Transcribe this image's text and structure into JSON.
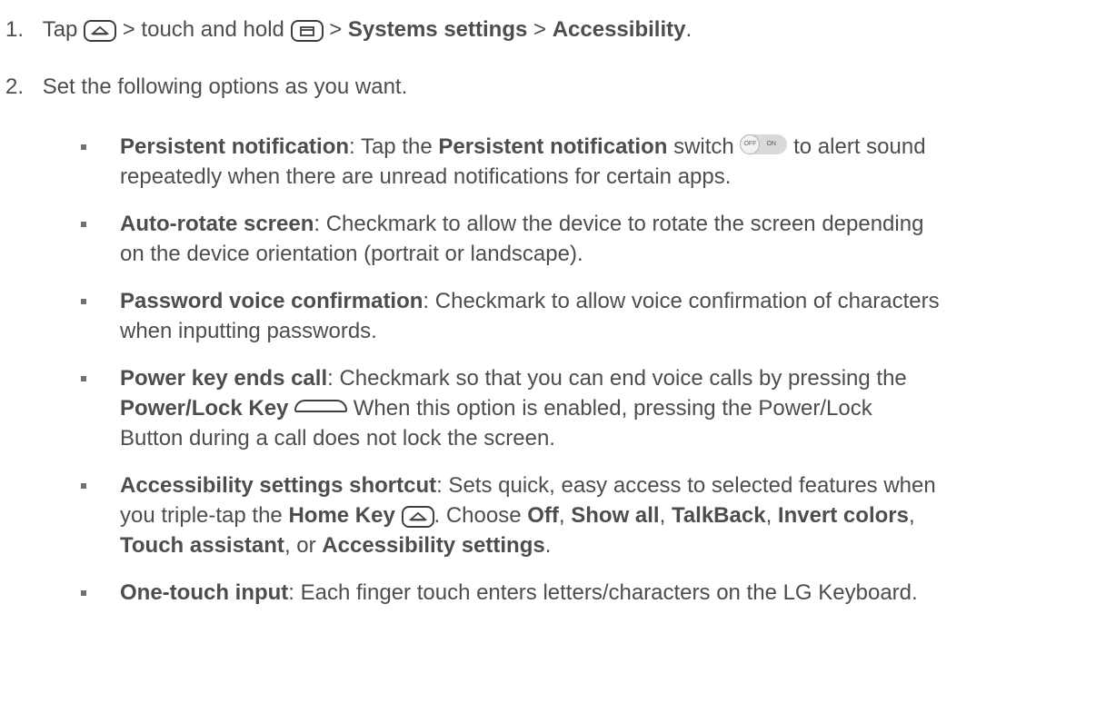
{
  "steps": [
    {
      "number": "1.",
      "pre": "Tap",
      "sep1": ">",
      "mid": "touch and hold",
      "sep2": ">",
      "b1": "Systems settings",
      "sep3": ">",
      "b2": "Accessibility",
      "end": "."
    },
    {
      "number": "2.",
      "text": "Set the following options as you want."
    }
  ],
  "options": {
    "persistent": {
      "title": "Persistent notification",
      "t1": ": Tap the",
      "b": "Persistent notification",
      "t2": "switch",
      "t3": "to alert sound",
      "line2": "repeatedly when there are unread notifications for certain apps.",
      "switch_off": "OFF",
      "switch_on": "ON"
    },
    "autorotate": {
      "title": "Auto-rotate screen",
      "t1": ": Checkmark to allow the device to rotate the screen depending",
      "line2": "on the device orientation (portrait or landscape)."
    },
    "password": {
      "title": "Password voice confirmation",
      "t1": ": Checkmark to allow voice confirmation of characters",
      "line2": "when inputting passwords."
    },
    "power": {
      "title": "Power key ends call",
      "t1": ": Checkmark so that you can end voice calls by pressing the",
      "b": "Power/Lock Key",
      "t2": "When this option is enabled, pressing the Power/Lock",
      "line3": "Button during a call does not lock the screen."
    },
    "shortcut": {
      "title": "Accessibility settings shortcut",
      "t1": ": Sets quick, easy access to selected features when",
      "l2a": "you triple-tap the",
      "l2b": "Home Key",
      "l2c": ". Choose",
      "o1": "Off",
      "c1": ",",
      "o2": "Show all",
      "c2": ",",
      "o3": "TalkBack",
      "c3": ",",
      "o4": "Invert colors",
      "c4": ",",
      "o5": "Touch assistant",
      "c5": ", or",
      "o6": "Accessibility settings",
      "end": "."
    },
    "onetouch": {
      "title": "One-touch input",
      "t1": ": Each finger touch enters letters/characters on the LG Keyboard."
    }
  },
  "icons": {
    "home": "home-key-icon",
    "recent": "recent-apps-key-icon",
    "switch": "off-on-switch-icon",
    "power": "power-lock-key-icon"
  }
}
